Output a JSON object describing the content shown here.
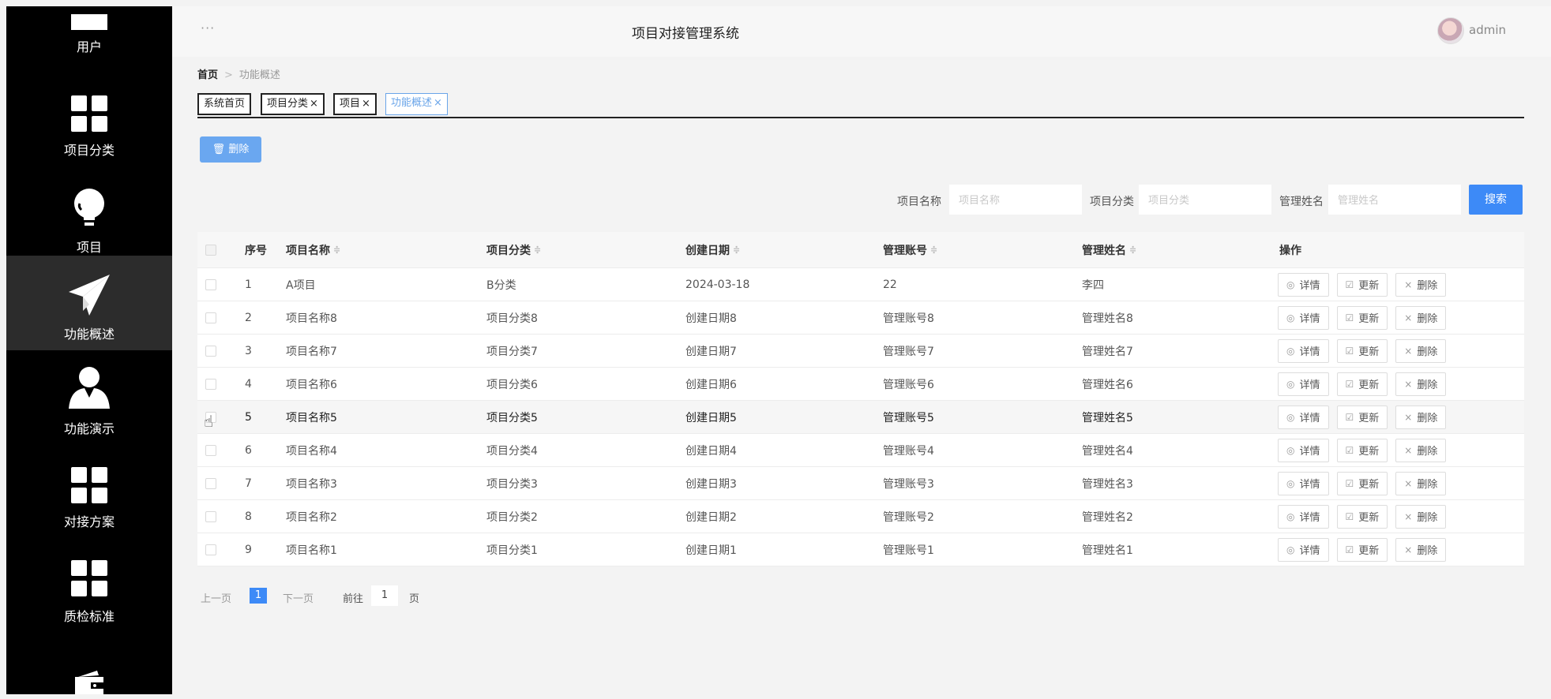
{
  "app": {
    "title": "项目对接管理系统",
    "user": "admin"
  },
  "sidebar": {
    "items": [
      {
        "label": "用户",
        "icon": "user-bar-icon"
      },
      {
        "label": "项目分类",
        "icon": "grid-icon"
      },
      {
        "label": "项目",
        "icon": "lightbulb-icon"
      },
      {
        "label": "功能概述",
        "icon": "paper-plane-icon",
        "active": true
      },
      {
        "label": "功能演示",
        "icon": "person-icon"
      },
      {
        "label": "对接方案",
        "icon": "grid-icon"
      },
      {
        "label": "质检标准",
        "icon": "grid-icon"
      },
      {
        "label": "",
        "icon": "wallet-icon"
      }
    ]
  },
  "breadcrumb": {
    "home": "首页",
    "separator": ">",
    "current": "功能概述"
  },
  "tabs": [
    {
      "label": "系统首页",
      "closable": false
    },
    {
      "label": "项目分类",
      "closable": true
    },
    {
      "label": "项目",
      "closable": true
    },
    {
      "label": "功能概述",
      "closable": true,
      "active": true
    }
  ],
  "tab_close_glyph": "×",
  "toolbar": {
    "delete_label": "删除",
    "delete_icon": "trash-icon"
  },
  "search": {
    "fields": [
      {
        "label": "项目名称",
        "placeholder": "项目名称"
      },
      {
        "label": "项目分类",
        "placeholder": "项目分类"
      },
      {
        "label": "管理姓名",
        "placeholder": "管理姓名"
      }
    ],
    "button": "搜索"
  },
  "table": {
    "columns": [
      "序号",
      "项目名称",
      "项目分类",
      "创建日期",
      "管理账号",
      "管理姓名",
      "操作"
    ],
    "sort_glyph": "≑",
    "actions": {
      "detail": "详情",
      "update": "更新",
      "delete": "删除",
      "detail_icon": "eye-icon",
      "update_icon": "edit-icon",
      "delete_icon": "close-icon"
    },
    "rows": [
      {
        "no": "1",
        "name": "A项目",
        "category": "B分类",
        "date": "2024-03-18",
        "account": "22",
        "manager": "李四"
      },
      {
        "no": "2",
        "name": "项目名称8",
        "category": "项目分类8",
        "date": "创建日期8",
        "account": "管理账号8",
        "manager": "管理姓名8"
      },
      {
        "no": "3",
        "name": "项目名称7",
        "category": "项目分类7",
        "date": "创建日期7",
        "account": "管理账号7",
        "manager": "管理姓名7"
      },
      {
        "no": "4",
        "name": "项目名称6",
        "category": "项目分类6",
        "date": "创建日期6",
        "account": "管理账号6",
        "manager": "管理姓名6"
      },
      {
        "no": "5",
        "name": "项目名称5",
        "category": "项目分类5",
        "date": "创建日期5",
        "account": "管理账号5",
        "manager": "管理姓名5",
        "hover": true
      },
      {
        "no": "6",
        "name": "项目名称4",
        "category": "项目分类4",
        "date": "创建日期4",
        "account": "管理账号4",
        "manager": "管理姓名4"
      },
      {
        "no": "7",
        "name": "项目名称3",
        "category": "项目分类3",
        "date": "创建日期3",
        "account": "管理账号3",
        "manager": "管理姓名3"
      },
      {
        "no": "8",
        "name": "项目名称2",
        "category": "项目分类2",
        "date": "创建日期2",
        "account": "管理账号2",
        "manager": "管理姓名2"
      },
      {
        "no": "9",
        "name": "项目名称1",
        "category": "项目分类1",
        "date": "创建日期1",
        "account": "管理账号1",
        "manager": "管理姓名1"
      }
    ]
  },
  "pagination": {
    "prev": "上一页",
    "current": "1",
    "next": "下一页",
    "goto_label": "前往",
    "goto_value": "1",
    "page_suffix": "页"
  },
  "colors": {
    "accent": "#3d8af7",
    "sidebar_bg": "#000000",
    "sidebar_active": "#2c2c2c",
    "delete_button": "#6aa7f0"
  }
}
